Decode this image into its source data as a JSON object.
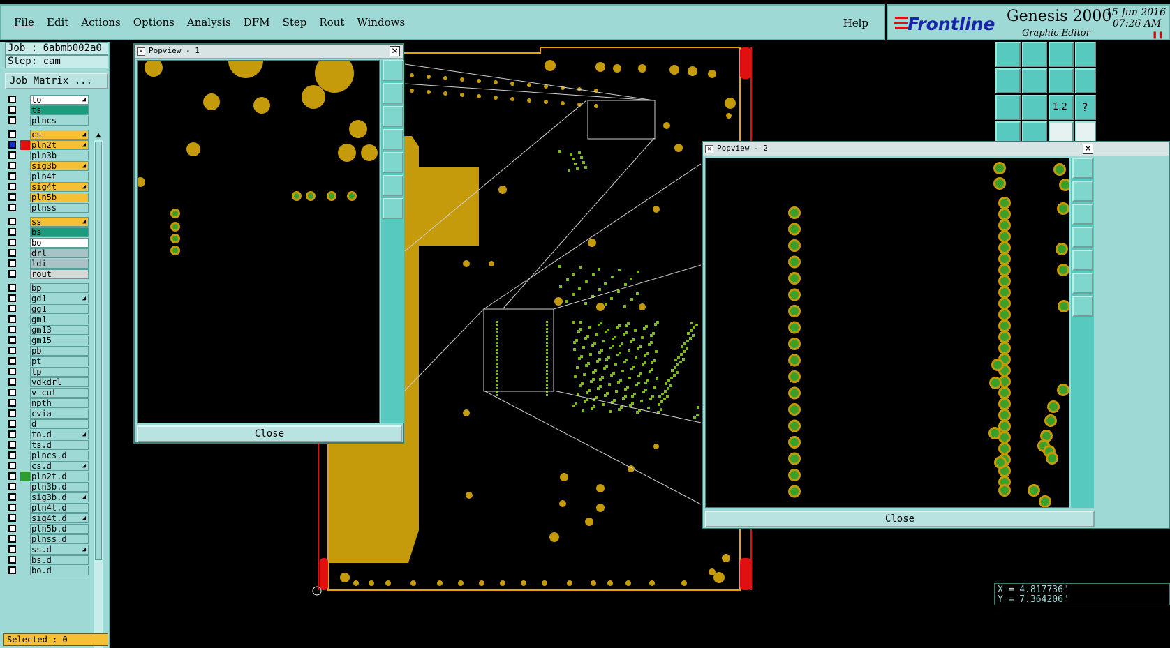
{
  "menu": {
    "items": [
      "File",
      "Edit",
      "Actions",
      "Options",
      "Analysis",
      "DFM",
      "Step",
      "Rout",
      "Windows"
    ],
    "help": "Help"
  },
  "brand": {
    "logo_text": "Frontline",
    "product": "Genesis 2000",
    "subtitle": "Graphic Editor",
    "date": "15 Jun 2016",
    "time": "07:26 AM"
  },
  "sidebar": {
    "job": "Job : 6abmb002a0",
    "step": "Step: cam",
    "job_matrix": "Job Matrix ...",
    "selected": "Selected : 0",
    "layers": [
      {
        "name": "to",
        "color": "#ffffff",
        "arrow": true
      },
      {
        "name": "ts",
        "color": "#1c9c7c",
        "arrow": false
      },
      {
        "name": "plncs",
        "color": "#9ed9d5",
        "arrow": false
      },
      {
        "name": "cs",
        "color": "#f6c036",
        "arrow": true
      },
      {
        "name": "pln2t",
        "color": "#f6c036",
        "arrow": true,
        "selected": true
      },
      {
        "name": "pln3b",
        "color": "#9ed9d5",
        "arrow": false
      },
      {
        "name": "sig3b",
        "color": "#f6c036",
        "arrow": true
      },
      {
        "name": "pln4t",
        "color": "#9ed9d5",
        "arrow": false
      },
      {
        "name": "sig4t",
        "color": "#f6c036",
        "arrow": true
      },
      {
        "name": "pln5b",
        "color": "#f6c036",
        "arrow": false
      },
      {
        "name": "plnss",
        "color": "#9ed9d5",
        "arrow": false
      },
      {
        "name": "ss",
        "color": "#f6c036",
        "arrow": true
      },
      {
        "name": "bs",
        "color": "#1c9c7c",
        "arrow": false
      },
      {
        "name": "bo",
        "color": "#ffffff",
        "arrow": false
      },
      {
        "name": "drl",
        "color": "#a7c3c6",
        "arrow": false
      },
      {
        "name": "ldi",
        "color": "#a7c3c6",
        "arrow": false
      },
      {
        "name": "rout",
        "color": "#d8d8d8",
        "arrow": false
      },
      {
        "name": "bp",
        "color": "#9ed9d5",
        "arrow": false
      },
      {
        "name": "gd1",
        "color": "#9ed9d5",
        "arrow": true
      },
      {
        "name": "gg1",
        "color": "#9ed9d5",
        "arrow": false
      },
      {
        "name": "gm1",
        "color": "#9ed9d5",
        "arrow": false
      },
      {
        "name": "gm13",
        "color": "#9ed9d5",
        "arrow": false
      },
      {
        "name": "gm15",
        "color": "#9ed9d5",
        "arrow": false
      },
      {
        "name": "pb",
        "color": "#9ed9d5",
        "arrow": false
      },
      {
        "name": "pt",
        "color": "#9ed9d5",
        "arrow": false
      },
      {
        "name": "tp",
        "color": "#9ed9d5",
        "arrow": false
      },
      {
        "name": "ydkdrl",
        "color": "#9ed9d5",
        "arrow": false
      },
      {
        "name": "v-cut",
        "color": "#9ed9d5",
        "arrow": false
      },
      {
        "name": "npth",
        "color": "#9ed9d5",
        "arrow": false
      },
      {
        "name": "cvia",
        "color": "#9ed9d5",
        "arrow": false
      },
      {
        "name": "d",
        "color": "#9ed9d5",
        "arrow": false
      },
      {
        "name": "to.d",
        "color": "#9ed9d5",
        "arrow": true
      },
      {
        "name": "ts.d",
        "color": "#9ed9d5",
        "arrow": false
      },
      {
        "name": "plncs.d",
        "color": "#9ed9d5",
        "arrow": false
      },
      {
        "name": "cs.d",
        "color": "#9ed9d5",
        "arrow": true
      },
      {
        "name": "pln2t.d",
        "color": "#9ed9d5",
        "arrow": false
      },
      {
        "name": "pln3b.d",
        "color": "#9ed9d5",
        "arrow": false
      },
      {
        "name": "sig3b.d",
        "color": "#9ed9d5",
        "arrow": true
      },
      {
        "name": "pln4t.d",
        "color": "#9ed9d5",
        "arrow": false
      },
      {
        "name": "sig4t.d",
        "color": "#9ed9d5",
        "arrow": true
      },
      {
        "name": "pln5b.d",
        "color": "#9ed9d5",
        "arrow": false
      },
      {
        "name": "plnss.d",
        "color": "#9ed9d5",
        "arrow": false
      },
      {
        "name": "ss.d",
        "color": "#9ed9d5",
        "arrow": true
      },
      {
        "name": "bs.d",
        "color": "#9ed9d5",
        "arrow": false
      },
      {
        "name": "bo.d",
        "color": "#9ed9d5",
        "arrow": false
      }
    ]
  },
  "popup1": {
    "title": "Popview - 1",
    "close": "Close"
  },
  "popup2": {
    "title": "Popview - 2",
    "close": "Close"
  },
  "coords": {
    "x": "X = 4.817736\"",
    "y": "Y = 7.364206\""
  },
  "colors": {
    "ui": "#9ed9d5",
    "copper": "#c59a0b",
    "pad": "#7fb51f",
    "board_edge": "#e01010"
  }
}
